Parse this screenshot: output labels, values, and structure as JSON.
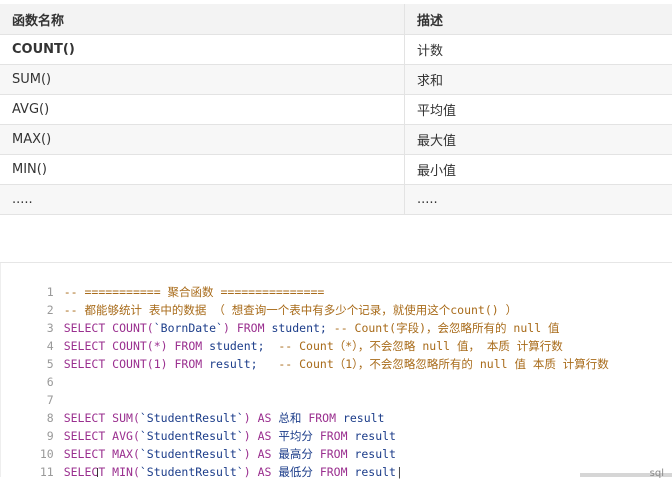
{
  "table": {
    "headers": [
      "函数名称",
      "描述"
    ],
    "rows": [
      [
        "COUNT()",
        "计数"
      ],
      [
        "SUM()",
        "求和"
      ],
      [
        "AVG()",
        "平均值"
      ],
      [
        "MAX()",
        "最大值"
      ],
      [
        "MIN()",
        "最小值"
      ],
      [
        ".....",
        "....."
      ]
    ]
  },
  "code": {
    "line_numbers": [
      "1",
      "2",
      "3",
      "4",
      "5",
      "6",
      "7",
      "8",
      "9",
      "10",
      "11"
    ],
    "l1": "-- =========== 聚合函数 ===============",
    "l2": "-- 都能够统计 表中的数据 （ 想查询一个表中有多少个记录，就使用这个count() ）",
    "l3": {
      "a": "SELECT ",
      "b": "COUNT(",
      "c": "`BornDate`",
      "d": ") ",
      "e": "FROM ",
      "f": "student; ",
      "g": "-- Count(字段)，会忽略所有的 null 值"
    },
    "l4": {
      "a": "SELECT ",
      "b": "COUNT(*) ",
      "e": "FROM ",
      "f": "student;  ",
      "g": "-- Count（*），不会忽略 null 值， 本质 计算行数"
    },
    "l5": {
      "a": "SELECT ",
      "b": "COUNT(1) ",
      "e": "FROM ",
      "f": "result;   ",
      "g": "-- Count（1），不会忽略忽略所有的 null 值 本质 计算行数"
    },
    "l8": {
      "a": "SELECT ",
      "b": "SUM(",
      "c": "`StudentResult`",
      "d": ") ",
      "k": "AS ",
      "t": "总和 ",
      "e": "FROM ",
      "f": "result"
    },
    "l9": {
      "a": "SELECT ",
      "b": "AVG(",
      "c": "`StudentResult`",
      "d": ") ",
      "k": "AS ",
      "t": "平均分 ",
      "e": "FROM ",
      "f": "result"
    },
    "l10": {
      "a": "SELECT ",
      "b": "MAX(",
      "c": "`StudentResult`",
      "d": ") ",
      "k": "AS ",
      "t": "最高分 ",
      "e": "FROM ",
      "f": "result"
    },
    "l11": {
      "a": "SELECT ",
      "b": "MIN(",
      "c": "`StudentResult`",
      "d": ") ",
      "k": "AS ",
      "t": "最低分 ",
      "e": "FROM ",
      "f": "result"
    },
    "lang_tag": "sql"
  }
}
